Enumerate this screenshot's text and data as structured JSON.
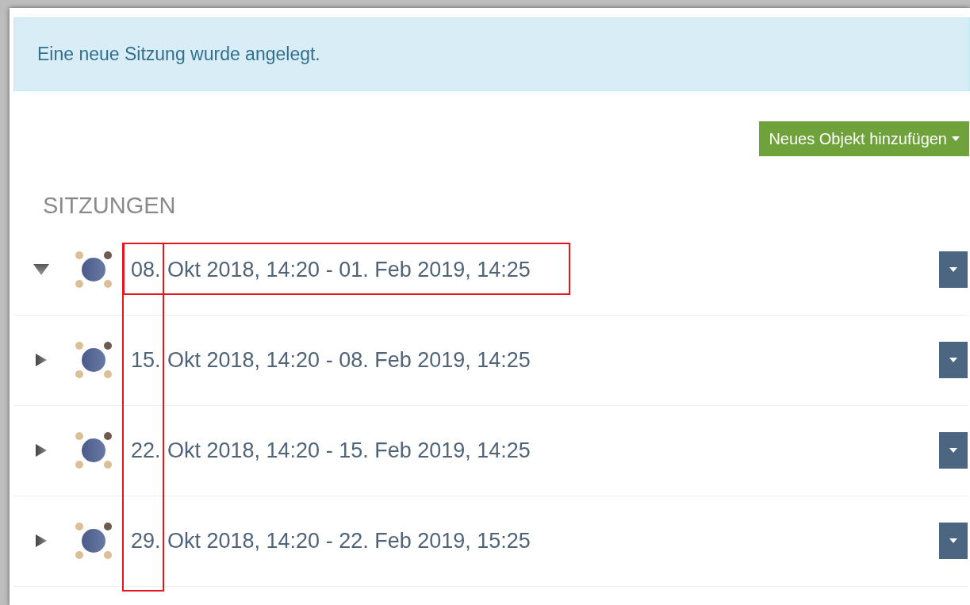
{
  "alert": {
    "text": "Eine neue Sitzung wurde angelegt."
  },
  "add_button": {
    "label": "Neues Objekt hinzufügen"
  },
  "section_title": "SITZUNGEN",
  "day_column_highlighted": true,
  "sessions": [
    {
      "day": "08.",
      "rest": "Okt 2018, 14:20 - 01. Feb 2019, 14:25",
      "expanded": true,
      "highlighted": true
    },
    {
      "day": "15.",
      "rest": "Okt 2018, 14:20 - 08. Feb 2019, 14:25",
      "expanded": false,
      "highlighted": false
    },
    {
      "day": "22.",
      "rest": "Okt 2018, 14:20 - 15. Feb 2019, 14:25",
      "expanded": false,
      "highlighted": false
    },
    {
      "day": "29.",
      "rest": "Okt 2018, 14:20 - 22. Feb 2019, 15:25",
      "expanded": false,
      "highlighted": false
    }
  ]
}
